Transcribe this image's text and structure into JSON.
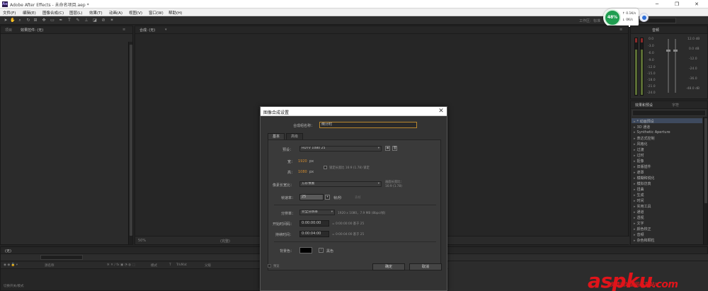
{
  "titlebar": {
    "icon": "Ae",
    "title": "Adobe After Effects - 未命名项目.aep *",
    "minimize": "─",
    "restore": "❐",
    "close": "✕"
  },
  "menu": [
    "文件(F)",
    "编辑(E)",
    "图像合成(C)",
    "图层(L)",
    "效果(T)",
    "动画(A)",
    "视图(V)",
    "窗口(W)",
    "帮助(H)"
  ],
  "toolbar": {
    "workspace_label": "工作区:",
    "workspace_value": "标准",
    "search_placeholder": "搜索帮助"
  },
  "project_panel": {
    "tab": "项目",
    "tab2": "效果控件: (无)"
  },
  "comp_panel": {
    "tab": "合成: (无)"
  },
  "footage_controls": {
    "zoom": "50%",
    "res": "(完整)"
  },
  "audio_panel": {
    "tab": "音频",
    "left_db": [
      "0.0",
      "-3.0",
      "-6.0",
      "-9.0",
      "-12.0",
      "-15.0",
      "-18.0",
      "-21.0",
      "-24.0"
    ],
    "right_db": [
      "12.0 dB",
      "0.0 dB",
      "-12.0",
      "-24.0",
      "-36.0",
      "-48.0 dB"
    ]
  },
  "effects_panel": {
    "tab": "效果和预设",
    "tab2": "字符",
    "items": [
      "* 动画预设",
      "3D 通道",
      "Synthetic Aperture",
      "表达式控制",
      "风格化",
      "过渡",
      "过时",
      "抠像",
      "旧版插件",
      "遮罩",
      "模糊和锐化",
      "模拟仿真",
      "扭曲",
      "生成",
      "时间",
      "实用工具",
      "通道",
      "透视",
      "文字",
      "颜色校正",
      "音频",
      "杂色和颗粒"
    ]
  },
  "timeline": {
    "tab": "(无)",
    "columns": [
      "源名称",
      "模式",
      "T",
      "TrkMat",
      "父级"
    ],
    "footer": "切换开关/模式"
  },
  "dialog": {
    "title": "图像合成设置",
    "close": "✕",
    "name_label": "合成组名称：",
    "name_value": "倒计时",
    "tabs": [
      "基本",
      "高级"
    ],
    "preset_label": "预设：",
    "preset_value": "HDTV 1080 25",
    "width_label": "宽：",
    "width_value": "1920",
    "height_label": "高：",
    "height_value": "1080",
    "unit": "px",
    "lock_ratio": "锁定长宽比 16:9 (1.78) 锁定",
    "par_label": "像素长宽比：",
    "par_value": "方形像素",
    "frame_ratio_label": "画面长宽比：",
    "frame_ratio_value": "16:9 (1.78)",
    "fps_label": "帧速率：",
    "fps_value": "25",
    "fps_unit": "帧/秒",
    "fps_drop": "丢帧",
    "res_label": "分辨率：",
    "res_value": "完全分辨率",
    "res_info": "1920 x 1080，7.9 MB (8bpc/帧)",
    "start_label": "开始时间码：",
    "start_value": "0:00:00:00",
    "start_info": "= 0:00:00:00  基于 25",
    "dur_label": "持续时间：",
    "dur_value": "0:00:04:00",
    "dur_info": "= 0:00:04:00  基于 25",
    "bg_label": "背景色：",
    "bg_name": "黑色",
    "preview": "预览",
    "ok": "确定",
    "cancel": "取消"
  },
  "net_widget": {
    "percent": "48%",
    "up": "0.1K/s",
    "down": "0K/s"
  },
  "watermark": {
    "brand": "aspku",
    "tld": ".com",
    "sub": "免费网站源码下载站!"
  }
}
